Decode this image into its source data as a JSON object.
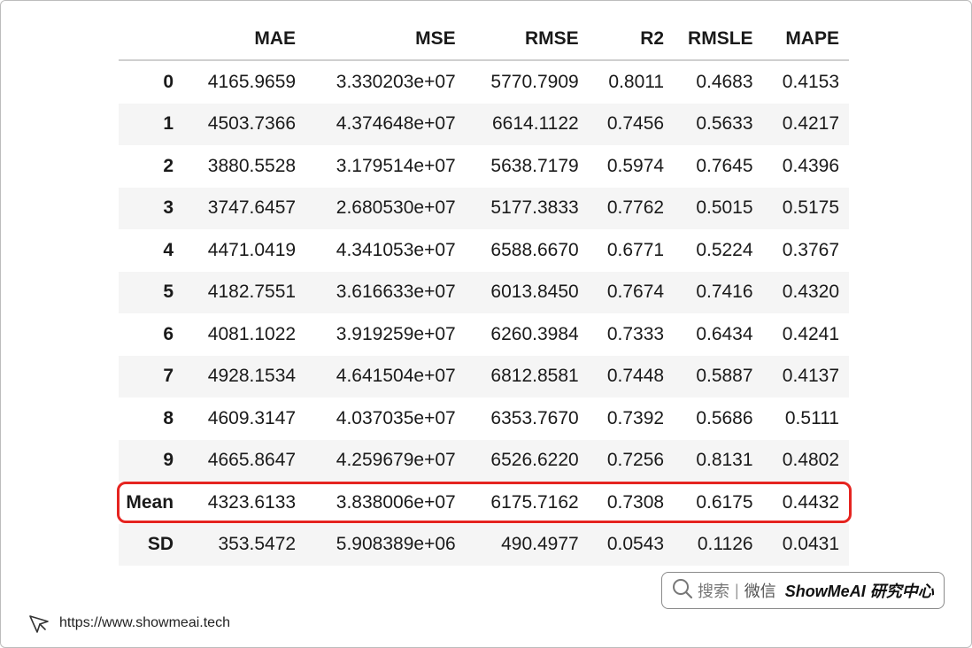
{
  "table": {
    "columns": [
      "",
      "MAE",
      "MSE",
      "RMSE",
      "R2",
      "RMSLE",
      "MAPE"
    ],
    "rows": [
      [
        "0",
        "4165.9659",
        "3.330203e+07",
        "5770.7909",
        "0.8011",
        "0.4683",
        "0.4153"
      ],
      [
        "1",
        "4503.7366",
        "4.374648e+07",
        "6614.1122",
        "0.7456",
        "0.5633",
        "0.4217"
      ],
      [
        "2",
        "3880.5528",
        "3.179514e+07",
        "5638.7179",
        "0.5974",
        "0.7645",
        "0.4396"
      ],
      [
        "3",
        "3747.6457",
        "2.680530e+07",
        "5177.3833",
        "0.7762",
        "0.5015",
        "0.5175"
      ],
      [
        "4",
        "4471.0419",
        "4.341053e+07",
        "6588.6670",
        "0.6771",
        "0.5224",
        "0.3767"
      ],
      [
        "5",
        "4182.7551",
        "3.616633e+07",
        "6013.8450",
        "0.7674",
        "0.7416",
        "0.4320"
      ],
      [
        "6",
        "4081.1022",
        "3.919259e+07",
        "6260.3984",
        "0.7333",
        "0.6434",
        "0.4241"
      ],
      [
        "7",
        "4928.1534",
        "4.641504e+07",
        "6812.8581",
        "0.7448",
        "0.5887",
        "0.4137"
      ],
      [
        "8",
        "4609.3147",
        "4.037035e+07",
        "6353.7670",
        "0.7392",
        "0.5686",
        "0.5111"
      ],
      [
        "9",
        "4665.8647",
        "4.259679e+07",
        "6526.6220",
        "0.7256",
        "0.8131",
        "0.4802"
      ],
      [
        "Mean",
        "4323.6133",
        "3.838006e+07",
        "6175.7162",
        "0.7308",
        "0.6175",
        "0.4432"
      ],
      [
        "SD",
        "353.5472",
        "5.908389e+06",
        "490.4977",
        "0.0543",
        "0.1126",
        "0.0431"
      ]
    ],
    "highlight_row": "Mean",
    "highlight_color": "#e52420"
  },
  "footer": {
    "url": "https://www.showmeai.tech",
    "icon": "cursor-arrow-icon"
  },
  "badge": {
    "search_label": "搜索",
    "separator": "|",
    "wechat_label": "微信",
    "brand": "ShowMeAI 研究中心",
    "icon": "search-icon"
  }
}
